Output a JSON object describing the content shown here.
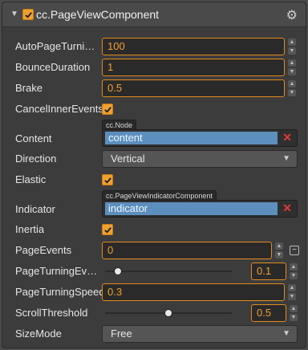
{
  "component": {
    "title": "cc.PageViewComponent",
    "enabled": true
  },
  "fields": {
    "autoPageTurning": {
      "label": "AutoPageTurnin...",
      "value": "100"
    },
    "bounceDuration": {
      "label": "BounceDuration",
      "value": "1"
    },
    "brake": {
      "label": "Brake",
      "value": "0.5"
    },
    "cancelInnerEvents": {
      "label": "CancelInnerEvents",
      "checked": true
    },
    "content": {
      "label": "Content",
      "type_tag": "cc.Node",
      "value": "content"
    },
    "direction": {
      "label": "Direction",
      "value": "Vertical"
    },
    "elastic": {
      "label": "Elastic",
      "checked": true
    },
    "indicator": {
      "label": "Indicator",
      "type_tag": "cc.PageViewIndicatorComponent",
      "value": "indicator"
    },
    "inertia": {
      "label": "Inertia",
      "checked": true
    },
    "pageEvents": {
      "label": "PageEvents",
      "value": "0"
    },
    "pageTurningEventTiming": {
      "label": "PageTurningEve...",
      "value": "0.1",
      "slider_fraction": 0.1
    },
    "pageTurningSpeed": {
      "label": "PageTurningSpeed",
      "value": "0.3"
    },
    "scrollThreshold": {
      "label": "ScrollThreshold",
      "value": "0.5",
      "slider_fraction": 0.5
    },
    "sizeMode": {
      "label": "SizeMode",
      "value": "Free"
    }
  },
  "colors": {
    "accent": "#f0a030",
    "object_selection": "#5c8fbd",
    "clear": "#e03a3a"
  }
}
